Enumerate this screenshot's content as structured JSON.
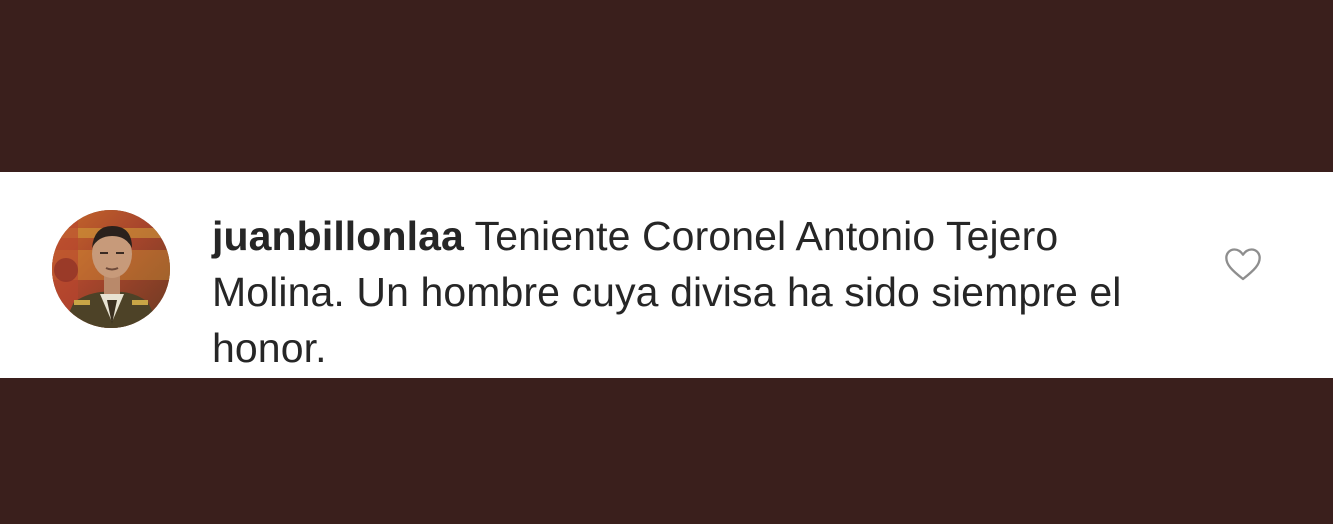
{
  "comment": {
    "username": "juanbillonlaa",
    "text": "Teniente Coronel Antonio Tejero Molina. Un hombre cuya divisa ha sido siempre el honor."
  },
  "icons": {
    "avatar": "profile-photo",
    "like": "heart-outline-icon"
  },
  "colors": {
    "background": "#3a1f1c",
    "comment_background": "#ffffff",
    "text": "#262626",
    "icon": "#8e8e8e"
  }
}
